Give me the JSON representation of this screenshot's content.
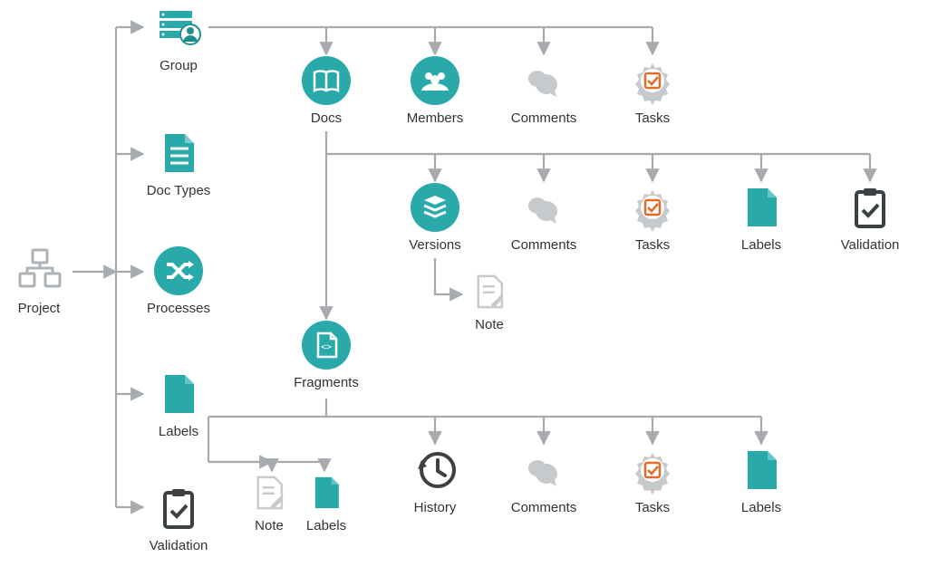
{
  "diagram": {
    "project": {
      "label": "Project"
    },
    "group": {
      "label": "Group"
    },
    "doc_types": {
      "label": "Doc Types"
    },
    "processes": {
      "label": "Processes"
    },
    "labels_proj": {
      "label": "Labels"
    },
    "validation_proj": {
      "label": "Validation"
    },
    "docs": {
      "label": "Docs"
    },
    "members": {
      "label": "Members"
    },
    "comments_grp": {
      "label": "Comments"
    },
    "tasks_grp": {
      "label": "Tasks"
    },
    "versions": {
      "label": "Versions"
    },
    "comments_doc": {
      "label": "Comments"
    },
    "tasks_doc": {
      "label": "Tasks"
    },
    "labels_doc": {
      "label": "Labels"
    },
    "validation_doc": {
      "label": "Validation"
    },
    "note_ver": {
      "label": "Note"
    },
    "fragments": {
      "label": "Fragments"
    },
    "history": {
      "label": "History"
    },
    "comments_frag": {
      "label": "Comments"
    },
    "tasks_frag": {
      "label": "Tasks"
    },
    "labels_frag": {
      "label": "Labels"
    },
    "note_frag": {
      "label": "Note"
    },
    "labels_frag2": {
      "label": "Labels"
    }
  },
  "colors": {
    "teal": "#2aa9aa",
    "teal_dark": "#1f8d8e",
    "grey": "#aeb3b7",
    "grey_light": "#c6cacd",
    "dark": "#3b4043",
    "orange": "#e06c2b",
    "connector": "#a7abaf",
    "text": "#333333"
  }
}
